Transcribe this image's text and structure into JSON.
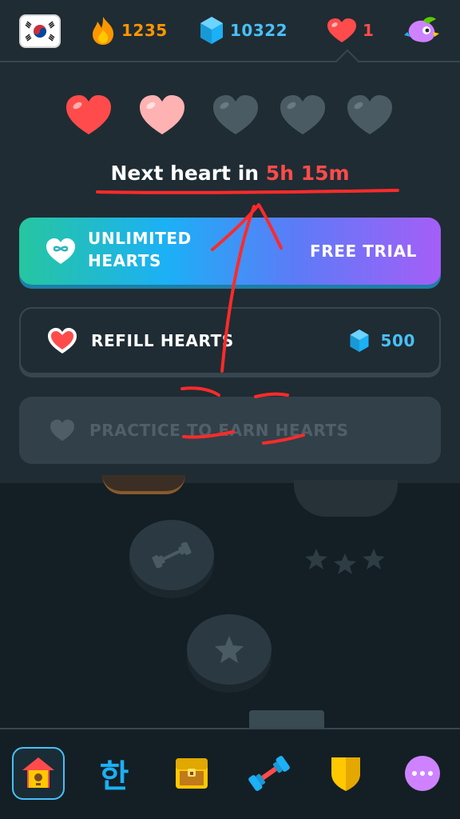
{
  "topbar": {
    "flag": "korean-flag-icon",
    "streak": {
      "icon": "flame-icon",
      "value": "1235",
      "color": "#ff9600"
    },
    "gems": {
      "icon": "gem-icon",
      "value": "10322",
      "color": "#49c0f8"
    },
    "hearts": {
      "icon": "heart-icon",
      "value": "1",
      "color": "#ff4b4b"
    },
    "profile": {
      "icon": "duo-character-icon"
    }
  },
  "popover": {
    "hearts": [
      {
        "state": "full",
        "color": "#ff4b4b"
      },
      {
        "state": "refilling",
        "color": "#ffb2b2"
      },
      {
        "state": "empty",
        "color": "#4b5b64"
      },
      {
        "state": "empty",
        "color": "#4b5b64"
      },
      {
        "state": "empty",
        "color": "#4b5b64"
      }
    ],
    "next_heart_prefix": "Next heart in",
    "next_heart_time": "5h 15m",
    "unlimited": {
      "label_line1": "UNLIMITED",
      "label_line2": "HEARTS",
      "action": "FREE TRIAL",
      "icon": "infinity-heart-icon"
    },
    "refill": {
      "label": "REFILL HEARTS",
      "cost": "500",
      "icon": "heart-icon",
      "cost_icon": "gem-icon"
    },
    "practice": {
      "label": "PRACTICE TO EARN HEARTS",
      "icon": "heart-outline-icon"
    }
  },
  "bottom_nav": {
    "items": [
      {
        "name": "home",
        "icon": "birdhouse-icon",
        "active": true
      },
      {
        "name": "characters",
        "label": "한",
        "icon": "hangul-icon"
      },
      {
        "name": "chest",
        "icon": "treasure-chest-icon"
      },
      {
        "name": "practice",
        "icon": "dumbbell-icon"
      },
      {
        "name": "leagues",
        "icon": "shield-icon"
      },
      {
        "name": "more",
        "icon": "more-icon"
      }
    ]
  },
  "colors": {
    "background": "#131f24",
    "panel": "#1f2c33",
    "accent_red": "#ff4b4b",
    "annotation": "#ff2a2a"
  }
}
